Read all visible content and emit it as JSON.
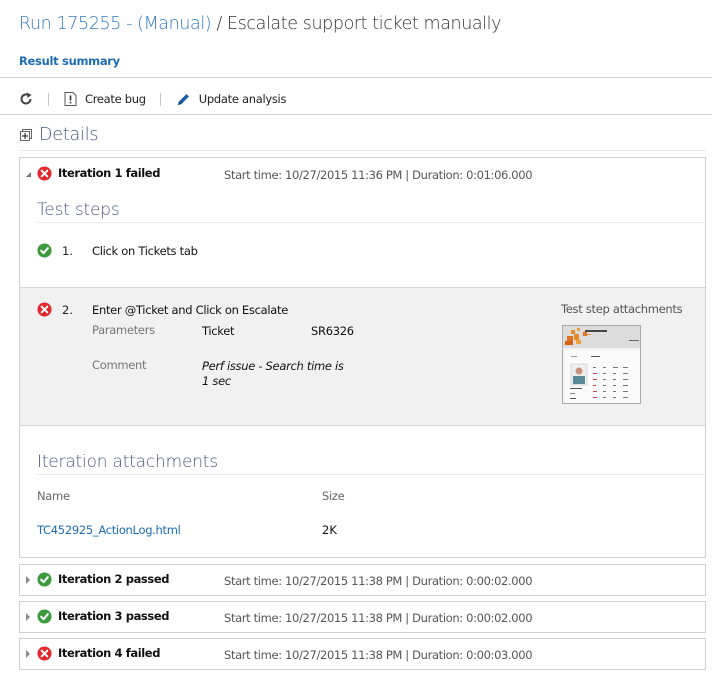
{
  "header": {
    "run_link": "Run 175255 - (Manual)",
    "separator": " / ",
    "test_name": "Escalate support ticket manually"
  },
  "tabs": {
    "result_summary": "Result summary"
  },
  "toolbar": {
    "refresh_icon": "refresh-icon",
    "create_bug_label": "Create bug",
    "update_analysis_label": "Update analysis"
  },
  "details": {
    "title": "Details"
  },
  "iterations": [
    {
      "title": "Iteration 1 failed",
      "status": "failed",
      "meta": "Start time: 10/27/2015 11:36 PM | Duration: 0:01:06.000",
      "expanded": true,
      "test_steps_title": "Test steps",
      "steps": [
        {
          "number": "1.",
          "status": "passed",
          "text": "Click on Tickets tab"
        },
        {
          "number": "2.",
          "status": "failed",
          "text": "Enter @Ticket and Click on Escalate",
          "parameters_label": "Parameters",
          "parameter_name": "Ticket",
          "parameter_value": "SR6326",
          "comment_label": "Comment",
          "comment": "Perf issue - Search time is 1 sec",
          "attachments_label": "Test step attachments"
        }
      ],
      "attachments_title": "Iteration attachments",
      "attachments_columns": [
        "Name",
        "Size"
      ],
      "attachments": [
        {
          "name": "TC452925_ActionLog.html",
          "size": "2K"
        }
      ]
    },
    {
      "title": "Iteration 2 passed",
      "status": "passed",
      "meta": "Start time: 10/27/2015 11:38 PM | Duration: 0:00:02.000",
      "expanded": false
    },
    {
      "title": "Iteration 3 passed",
      "status": "passed",
      "meta": "Start time: 10/27/2015 11:38 PM | Duration: 0:00:02.000",
      "expanded": false
    },
    {
      "title": "Iteration 4 failed",
      "status": "failed",
      "meta": "Start time: 10/27/2015 11:38 PM | Duration: 0:00:03.000",
      "expanded": false
    }
  ],
  "colors": {
    "link": "#1c6db5",
    "heading": "#4d5a80",
    "failed": "#e0282f",
    "passed": "#3c9a3c"
  }
}
